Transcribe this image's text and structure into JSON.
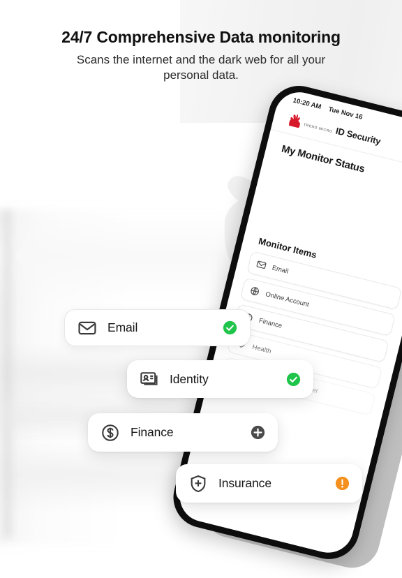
{
  "headline": {
    "title": "24/7 Comprehensive Data monitoring",
    "subtitle": "Scans the internet and the dark web for all your personal data."
  },
  "colors": {
    "green_check": "#1fc44a",
    "orange_alert": "#f5901e",
    "plus_dark": "#4a4a4a",
    "brand_red": "#d7192c",
    "text_dark": "#161616"
  },
  "phone": {
    "status_bar": {
      "time": "10:20 AM",
      "date": "Tue Nov 16"
    },
    "brand": {
      "company": "TREND MICRO",
      "product_light": "ID ",
      "product": "ID Security",
      "logo_icon": "trend-micro-ball-icon"
    },
    "screen_title": "My Monitor Status",
    "monitor_section_title": "Monitor Items",
    "monitor_items": [
      {
        "label": "Email",
        "icon": "envelope-icon"
      },
      {
        "label": "Online Account",
        "icon": "globe-icon"
      },
      {
        "label": "Finance",
        "icon": "dollar-circle-icon"
      },
      {
        "label": "Health",
        "icon": "heart-icon"
      },
      {
        "label": "Social Insurance Number",
        "icon": "card-icon"
      }
    ]
  },
  "floating_cards": [
    {
      "label": "Email",
      "icon": "envelope-icon",
      "badge": "check-circle-icon",
      "badge_color": "#1fc44a"
    },
    {
      "label": "Identity",
      "icon": "id-card-icon",
      "badge": "check-circle-icon",
      "badge_color": "#1fc44a"
    },
    {
      "label": "Finance",
      "icon": "dollar-circle-icon",
      "badge": "plus-circle-icon",
      "badge_color": "#4a4a4a"
    },
    {
      "label": "Insurance",
      "icon": "shield-cross-icon",
      "badge": "warning-circle-icon",
      "badge_color": "#f5901e"
    }
  ],
  "watermark": {
    "icon": "trend-micro-ball-watermark"
  }
}
